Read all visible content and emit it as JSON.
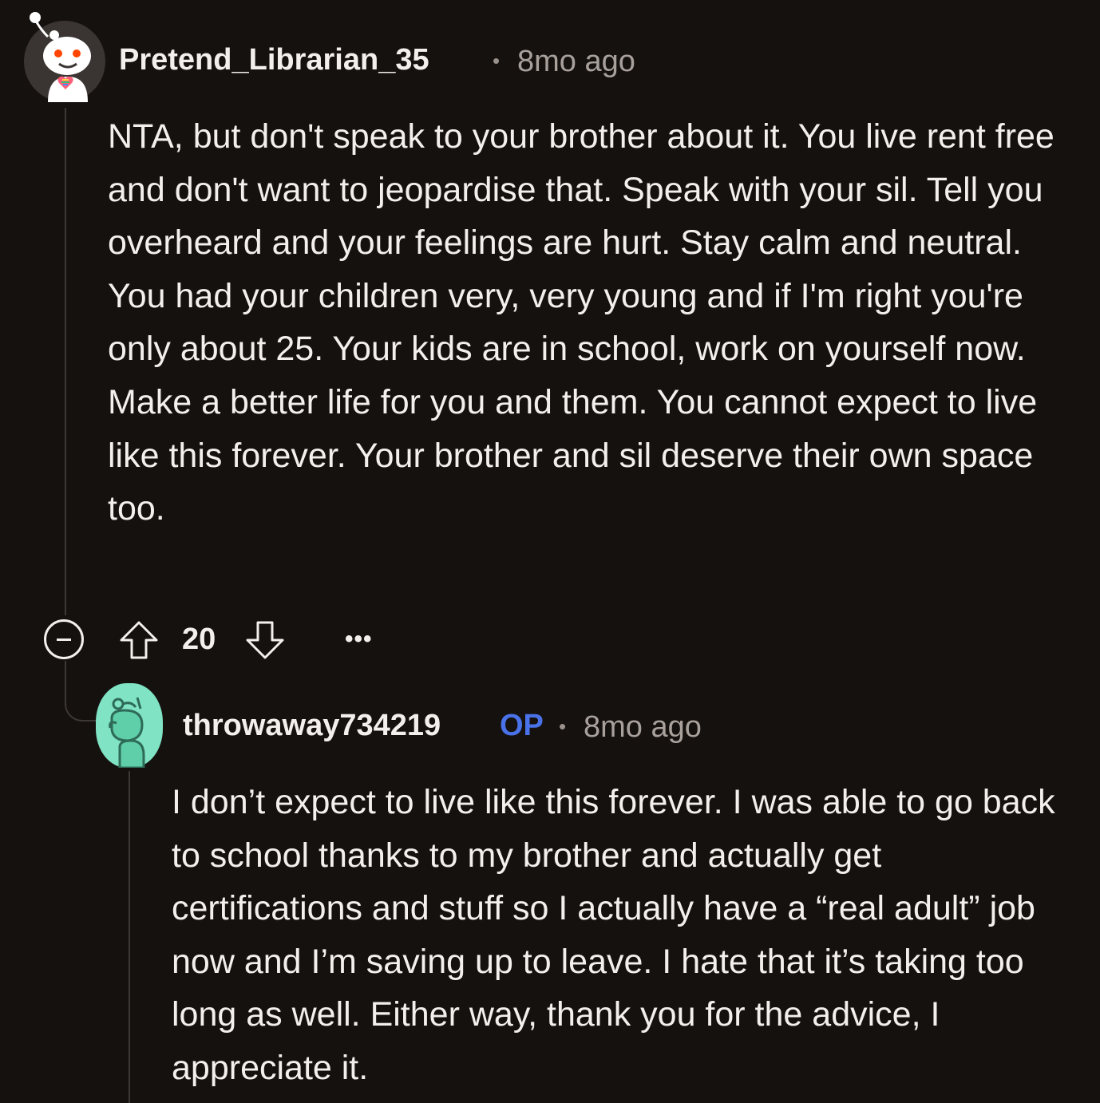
{
  "comments": [
    {
      "username": "Pretend_Librarian_35",
      "separator": "•",
      "timestamp": "8mo ago",
      "body": "NTA, but don't speak to your brother about it. You live rent free and don't want to jeopardise that. Speak with your sil. Tell you overheard and your feelings are hurt. Stay calm and neutral. You had your children very, very young and if I'm right you're only about 25. Your kids are in school, work on yourself now. Make a better life for you and them. You cannot expect to live like this forever. Your brother and sil deserve their own space too.",
      "vote_count": "20",
      "more_label": "•••",
      "avatar_icon": "snoo-avatar-icon"
    },
    {
      "username": "throwaway734219",
      "op_badge": "OP",
      "separator": "•",
      "timestamp": "8mo ago",
      "body": "I don’t expect to live like this forever. I was able to go back to school thanks to my brother and actually get certifications and stuff so I actually have a “real adult” job now and I’m saving up to leave. I hate that it’s taking too long as well. Either way, thank you for the advice, I appreciate it.",
      "avatar_icon": "snoo-avatar-icon"
    }
  ],
  "colors": {
    "background": "#15110f",
    "text": "#f2efed",
    "muted": "#a8a09b",
    "op_badge": "#4a72e8",
    "thread_line": "#3d3835"
  },
  "icons": [
    "collapse-icon",
    "upvote-icon",
    "downvote-icon",
    "more-options-icon"
  ]
}
